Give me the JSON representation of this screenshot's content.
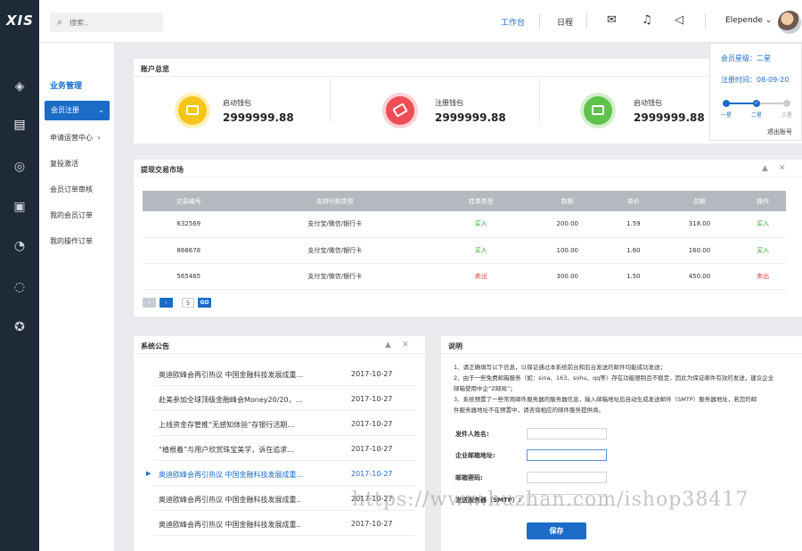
{
  "app": {
    "logo": "XIS"
  },
  "nav_icons": [
    "layers-icon",
    "document-icon",
    "globe-icon",
    "wallet-icon",
    "chart-icon",
    "chat-icon",
    "award-icon"
  ],
  "topbar": {
    "search_placeholder": "搜索..",
    "workbench": "工作台",
    "schedule": "日程",
    "username": "Elepende"
  },
  "submenu": {
    "title": "业务管理",
    "active_item": "会员注册",
    "items": [
      "申请运营中心",
      "复投激活",
      "会员订单审核",
      "我的会员订单",
      "我的操作订单"
    ]
  },
  "account": {
    "title": "账户总览",
    "wallets": [
      {
        "label": "启动钱包",
        "amount": "2999999.88",
        "color": "#f5c518"
      },
      {
        "label": "注册钱包",
        "amount": "2999999.88",
        "color": "#ef4d55"
      },
      {
        "label": "启动钱包",
        "amount": "2999999.88",
        "color": "#5ec24b"
      }
    ]
  },
  "member": {
    "level_label": "会员星级：",
    "level_value": "二星",
    "reg_label": "注册时间：",
    "reg_value": "08-09-20",
    "levels": [
      "一星",
      "二星",
      "三星"
    ],
    "logout": "退出账号"
  },
  "market": {
    "title": "提现交易市场",
    "columns": [
      "交易编号",
      "支持付款类型",
      "挂单类型",
      "数额",
      "单价",
      "总额",
      "操作"
    ],
    "rows": [
      {
        "id": "632569",
        "pay": "支付宝/微信/银行卡",
        "type": "买入",
        "amount": "200.00",
        "price": "1.59",
        "total": "318.00",
        "op": "买入",
        "kind": "buy"
      },
      {
        "id": "868678",
        "pay": "支付宝/微信/银行卡",
        "type": "买入",
        "amount": "100.00",
        "price": "1.60",
        "total": "160.00",
        "op": "买入",
        "kind": "buy"
      },
      {
        "id": "565465",
        "pay": "支付宝/微信/银行卡",
        "type": "卖出",
        "amount": "300.00",
        "price": "1.50",
        "total": "450.00",
        "op": "卖出",
        "kind": "sell"
      }
    ],
    "pager": {
      "page": "5",
      "go": "GO"
    }
  },
  "notices": {
    "title": "系统公告",
    "items": [
      {
        "title": "奥迪欧峰会再引热议 中国金融科技发展成重...",
        "date": "2017-10-27"
      },
      {
        "title": "赴美参加全球顶级金融峰会Money20/20，...",
        "date": "2017-10-27"
      },
      {
        "title": "上线资金存管推“无感知体验”存银行活期...",
        "date": "2017-10-27"
      },
      {
        "title": "“植根着”与用户欣赏珠宝美学，诉在追求...",
        "date": "2017-10-27"
      },
      {
        "title": "奥迪欧峰会再引热议 中国金融科技发展成重...",
        "date": "2017-10-27"
      },
      {
        "title": "奥迪欧峰会再引热议 中国金融科技发展成重..",
        "date": "2017-10-27"
      },
      {
        "title": "奥迪欧峰会再引热议 中国金融科技发展成重..",
        "date": "2017-10-27"
      }
    ]
  },
  "explain": {
    "title": "说明",
    "p1": "1、请正确填写以下信息，以保证通过本系统前台和后台发送的邮件均能成功发送；",
    "p2a": "2、由于一些免费邮箱服务（如：sina、163、sohu、qq等）存在功能限制且不稳定，因此为保证邮件有效的发送，建议企业",
    "p2b": "邮箱使用中企“Z邮局”；",
    "p3a": "3、系统预置了一些常用邮件服务器的服务器信息，输入邮箱地址后自动生成发送邮件（SMTP）服务器地址，若您的邮",
    "p3b": "件服务器地址不在预置中，请咨询相应的邮件服务提供商。",
    "fields": [
      "发件人姓名:",
      "企业邮箱地址:",
      "邮箱密码:",
      "发送服务器（SMTP）:"
    ],
    "save": "保存"
  },
  "watermark": "https://www.huzhan.com/ishop38417"
}
